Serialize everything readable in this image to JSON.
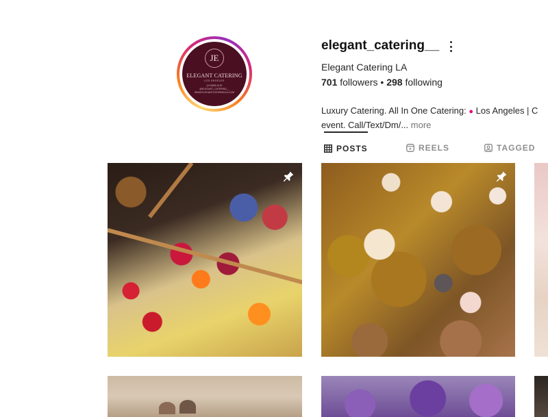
{
  "profile": {
    "username": "elegant_catering__",
    "display_name": "Elegant Catering LA",
    "followers": "701",
    "followers_label": "followers",
    "separator": "•",
    "following": "298",
    "following_label": "following",
    "bio_part1": "Luxury Catering. All In One Catering: ",
    "bio_part2": " Los Angeles | C",
    "bio_line2": "event. Call/Text/Dm/...",
    "bio_more": "more",
    "avatar": {
      "logo_initials": "JE",
      "logo_title": "ELEGANT CATERING",
      "logo_subtitle": "LOS ANGELES",
      "logo_contact": "(213)555-0132",
      "logo_handle": "@ELEGANT_CATERING__",
      "logo_website": "WWW.ELEGANTCATERINGLA.COM"
    }
  },
  "tabs": [
    {
      "label": "POSTS",
      "icon": "grid-icon",
      "active": true
    },
    {
      "label": "REELS",
      "icon": "reels-icon",
      "active": false
    },
    {
      "label": "TAGGED",
      "icon": "tagged-icon",
      "active": false
    }
  ],
  "posts": [
    {
      "subject": "fruit-platter",
      "pinned": true,
      "icon": "pin-icon"
    },
    {
      "subject": "chocolate-cupcakes",
      "pinned": true,
      "icon": "pin-icon"
    },
    {
      "subject": "pink-dessert",
      "pinned": false
    },
    {
      "subject": "desserts-table",
      "pinned": false
    },
    {
      "subject": "purple-flowers",
      "pinned": false
    },
    {
      "subject": "dark-decor",
      "pinned": false
    }
  ],
  "colors": {
    "text": "#262626",
    "secondary": "#737373",
    "avatar_bg": "#4a1022",
    "bio_pin": "#e6007a"
  }
}
